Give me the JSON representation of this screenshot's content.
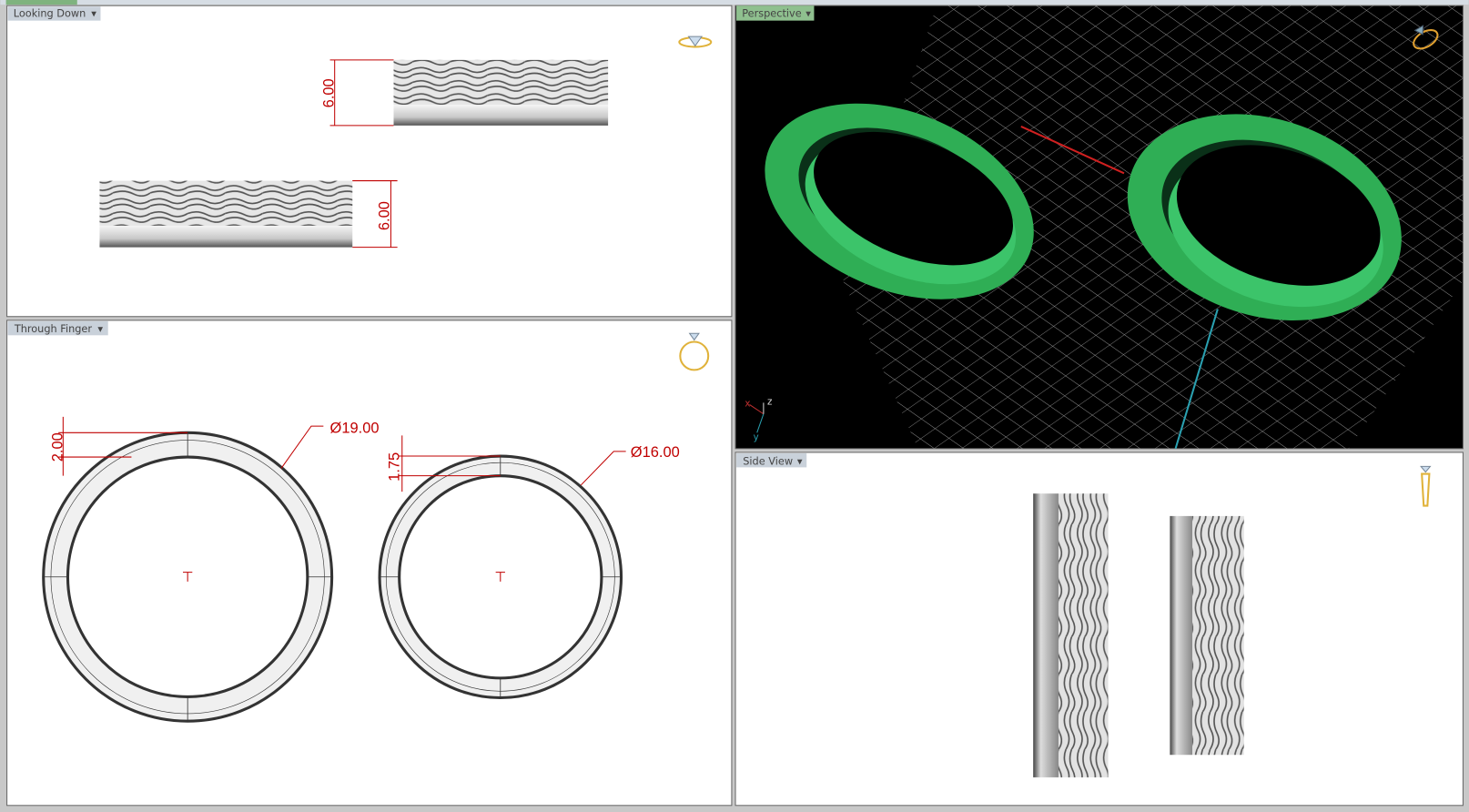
{
  "viewports": {
    "looking_down": {
      "label": "Looking Down",
      "dims": [
        "6.00",
        "6.00"
      ]
    },
    "through_finger": {
      "label": "Through Finger",
      "dims": {
        "diameter_large": "Ø19.00",
        "diameter_small": "Ø16.00",
        "thickness_large": "2.00",
        "thickness_small": "1.75"
      }
    },
    "perspective": {
      "label": "Perspective",
      "axes": {
        "x": "x",
        "y": "y",
        "z": "z"
      }
    },
    "side_view": {
      "label": "Side View"
    }
  },
  "colors": {
    "ring_green": "#2fae55",
    "dimension_red": "#c00000",
    "active_tab": "#8fc08f",
    "viewport_tab": "#c9d1da",
    "icon_gold": "#e0b23a"
  }
}
